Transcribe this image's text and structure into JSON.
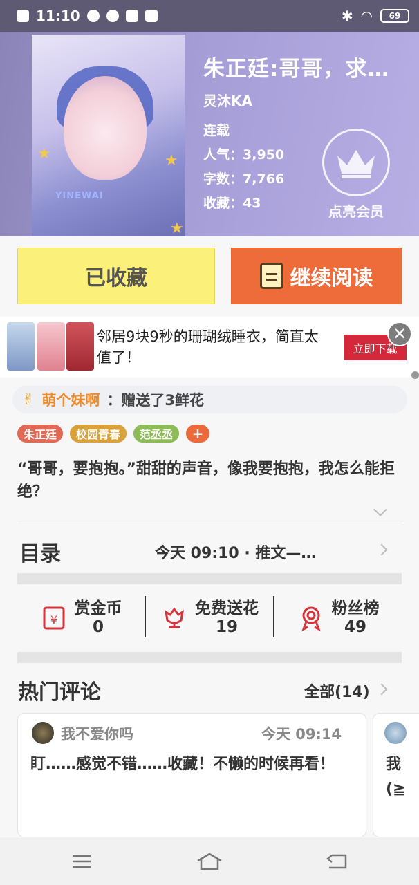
{
  "status_bar": {
    "time": "11:10",
    "battery": "69"
  },
  "book": {
    "title": "朱正廷:哥哥，求…",
    "author": "灵沐KA",
    "status": "连载",
    "popularity": "人气：3,950",
    "word_count": "字数：7,766",
    "favorites": "收藏：43",
    "vip_label": "点亮会员",
    "cover_text": "YINEWAI"
  },
  "actions": {
    "favorited_label": "已收藏",
    "continue_label": "继续阅读"
  },
  "ad": {
    "text": "邻居9块9秒的珊瑚绒睡衣，简直太值了！",
    "button": "立即下载",
    "close": "✕"
  },
  "gift": {
    "user": "萌个妹啊",
    "message": "：赠送了3鲜花"
  },
  "tags": [
    {
      "label": "朱正廷",
      "color": "#e06a55"
    },
    {
      "label": "校园青春",
      "color": "#d9a23a"
    },
    {
      "label": "范丞丞",
      "color": "#8dbb57"
    },
    {
      "label": "+",
      "color": "#ea6a3c"
    }
  ],
  "intro": "“哥哥，要抱抱。”甜甜的声音，像我要抱抱，我怎么能拒绝？",
  "toc": {
    "label": "目录",
    "latest": "今天 09:10 · 推文—…"
  },
  "stats": [
    {
      "label": "赏金币",
      "value": "0",
      "icon": "red-envelope-icon"
    },
    {
      "label": "免费送花",
      "value": "19",
      "icon": "flower-icon"
    },
    {
      "label": "粉丝榜",
      "value": "49",
      "icon": "medal-icon"
    }
  ],
  "hot_comments": {
    "title": "热门评论",
    "all_label": "全部(14)",
    "items": [
      {
        "user": "我不爱你吗",
        "time": "今天 09:14",
        "body": "盯……感觉不错……收藏！不懒的时候再看！"
      },
      {
        "body_line1": "我",
        "body_line2": "(≧"
      }
    ]
  },
  "colors": {
    "accent_orange": "#ee6b3a",
    "fav_yellow": "#fbf17a",
    "ad_red": "#d4293b"
  }
}
